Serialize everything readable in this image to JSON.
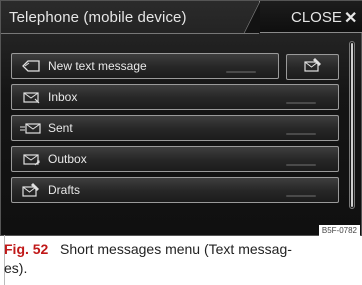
{
  "header": {
    "title": "Telephone (mobile device)",
    "close_label": "CLOSE",
    "close_symbol": "✕"
  },
  "menu": {
    "items": [
      {
        "label": "New text message",
        "icon": "new-message-icon"
      },
      {
        "label": "Inbox",
        "icon": "inbox-icon"
      },
      {
        "label": "Sent",
        "icon": "sent-icon"
      },
      {
        "label": "Outbox",
        "icon": "outbox-icon"
      },
      {
        "label": "Drafts",
        "icon": "drafts-icon"
      }
    ],
    "side_button_icon": "drafts-icon"
  },
  "reference_code": "B5F-0782",
  "caption": {
    "figure": "Fig. 52",
    "text": "Short messages menu (Text messag-\nes)."
  },
  "colors": {
    "screen_bg": "#151515",
    "text": "#e8e8e8",
    "figure_label": "#c01818"
  }
}
